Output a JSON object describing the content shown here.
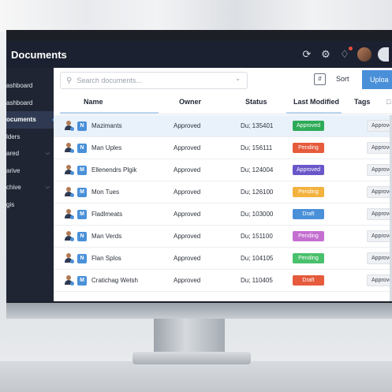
{
  "app": {
    "title": "Documents"
  },
  "topbar": {
    "icons": [
      "refresh-icon",
      "gear-icon",
      "bell-icon",
      "user-avatar"
    ]
  },
  "sidebar": {
    "items": [
      {
        "label": "ashboard",
        "active": false,
        "has_chevron": false
      },
      {
        "label": "ashboard",
        "active": false,
        "has_chevron": false
      },
      {
        "label": "ocuments",
        "active": true,
        "has_chevron": false
      },
      {
        "label": "lders",
        "active": false,
        "has_chevron": false
      },
      {
        "label": "ared",
        "active": false,
        "has_chevron": true
      },
      {
        "label": "arive",
        "active": false,
        "has_chevron": false
      },
      {
        "label": "chive",
        "active": false,
        "has_chevron": true
      },
      {
        "label": "gis",
        "active": false,
        "has_chevron": false
      }
    ]
  },
  "toolbar": {
    "search_placeholder": "Search documents...",
    "filter_glyph": "⇵",
    "sort_label": "Sort",
    "upload_label": "Uploa"
  },
  "table": {
    "columns": [
      "Name",
      "Owner",
      "Status",
      "Last Modified",
      "Tags"
    ],
    "rows": [
      {
        "doc": "N",
        "name": "Mazimants",
        "owner": "Approved",
        "status": "Du; 135401",
        "badge": "Approved",
        "badge_color": "#2eab58",
        "tag": "Approved",
        "selected": true
      },
      {
        "doc": "N",
        "name": "Man Uples",
        "owner": "Approved",
        "status": "Du; 156111",
        "badge": "Pending",
        "badge_color": "#e55b3c",
        "tag": "Approved",
        "selected": false
      },
      {
        "doc": "M",
        "name": "Ellenendrs Plgik",
        "owner": "Approved",
        "status": "Du; 124004",
        "badge": "Approved",
        "badge_color": "#6a57c9",
        "tag": "Approved",
        "selected": false
      },
      {
        "doc": "M",
        "name": "Mon Tues",
        "owner": "Approved",
        "status": "Du; 126100",
        "badge": "Pending",
        "badge_color": "#f3b23d",
        "tag": "Approved",
        "selected": false
      },
      {
        "doc": "M",
        "name": "Fladlmeats",
        "owner": "Approved",
        "status": "Du; 103000",
        "badge": "Draft",
        "badge_color": "#4a90d9",
        "tag": "Approved",
        "selected": false
      },
      {
        "doc": "N",
        "name": "Man Verds",
        "owner": "Approved",
        "status": "Du; 151100",
        "badge": "Pending",
        "badge_color": "#c46fd0",
        "tag": "Approved",
        "selected": false
      },
      {
        "doc": "N",
        "name": "Flan Splos",
        "owner": "Approved",
        "status": "Du; 104105",
        "badge": "Pending",
        "badge_color": "#49c06c",
        "tag": "Approved",
        "selected": false
      },
      {
        "doc": "M",
        "name": "Cratichag Wetsh",
        "owner": "Approved",
        "status": "Du; 110405",
        "badge": "Draft",
        "badge_color": "#e55b3c",
        "tag": "Approved",
        "selected": false
      }
    ]
  }
}
